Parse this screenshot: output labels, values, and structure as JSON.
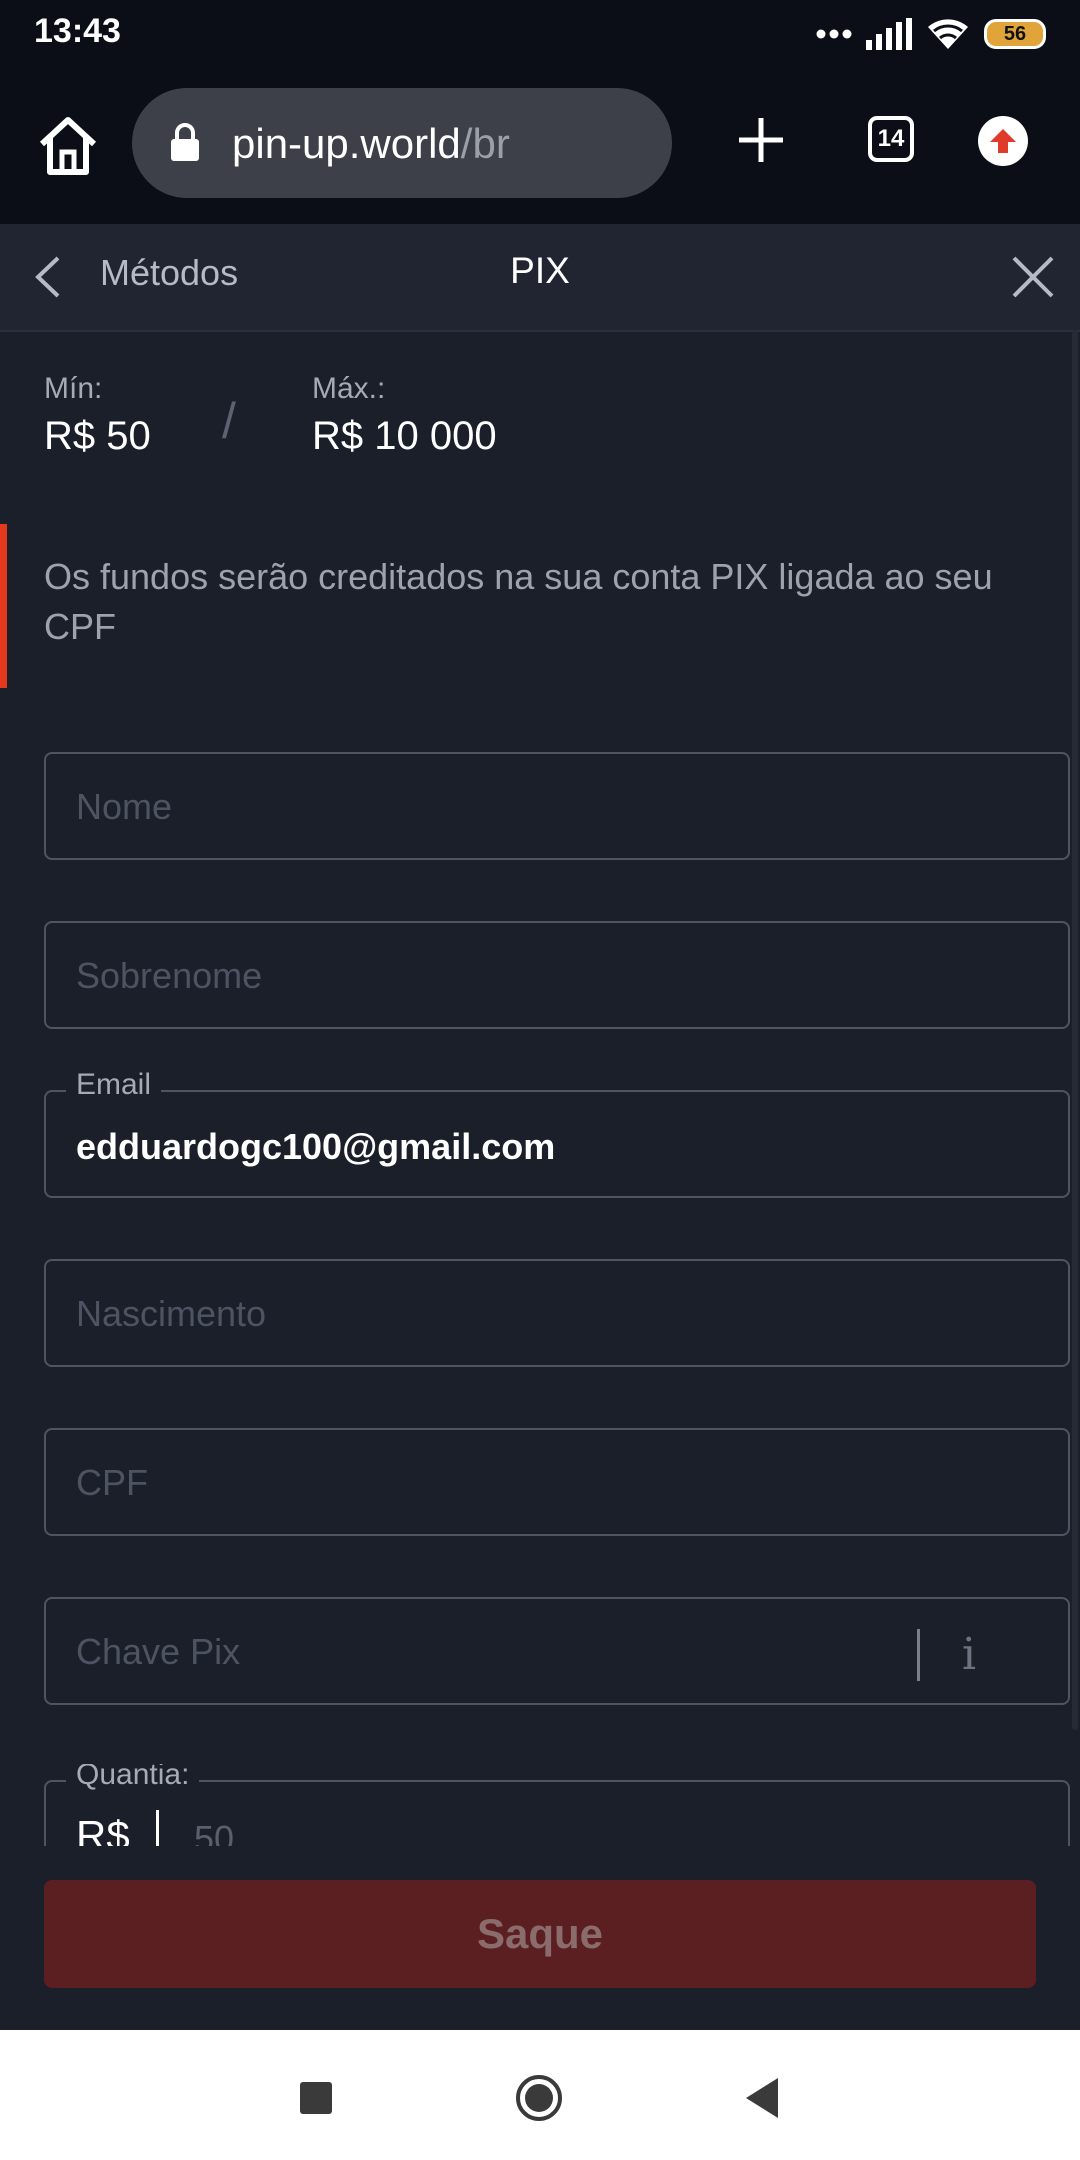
{
  "status": {
    "time": "13:43",
    "battery": "56"
  },
  "browser": {
    "url_host": "pin-up.world",
    "url_path": "/br",
    "tab_count": "14"
  },
  "header": {
    "back_label": "Métodos",
    "title": "PIX"
  },
  "limits": {
    "min_label": "Mín:",
    "min_value": "R$ 50",
    "separator": "/",
    "max_label": "Máx.:",
    "max_value": "R$ 10 000"
  },
  "info_text": "Os fundos serão creditados na sua conta PIX ligada ao seu CPF",
  "form": {
    "nome_placeholder": "Nome",
    "sobrenome_placeholder": "Sobrenome",
    "email_label": "Email",
    "email_value": "edduardogc100@gmail.com",
    "nascimento_placeholder": "Nascimento",
    "cpf_placeholder": "CPF",
    "chave_pix_placeholder": "Chave Pix",
    "info_glyph": "i",
    "amount_label": "Quantia:",
    "currency": "R$",
    "amount_placeholder": "50"
  },
  "submit_label": "Saque",
  "colors": {
    "background": "#1b1f2a",
    "accent": "#e4381f",
    "submit_bg": "#5c1f21"
  }
}
